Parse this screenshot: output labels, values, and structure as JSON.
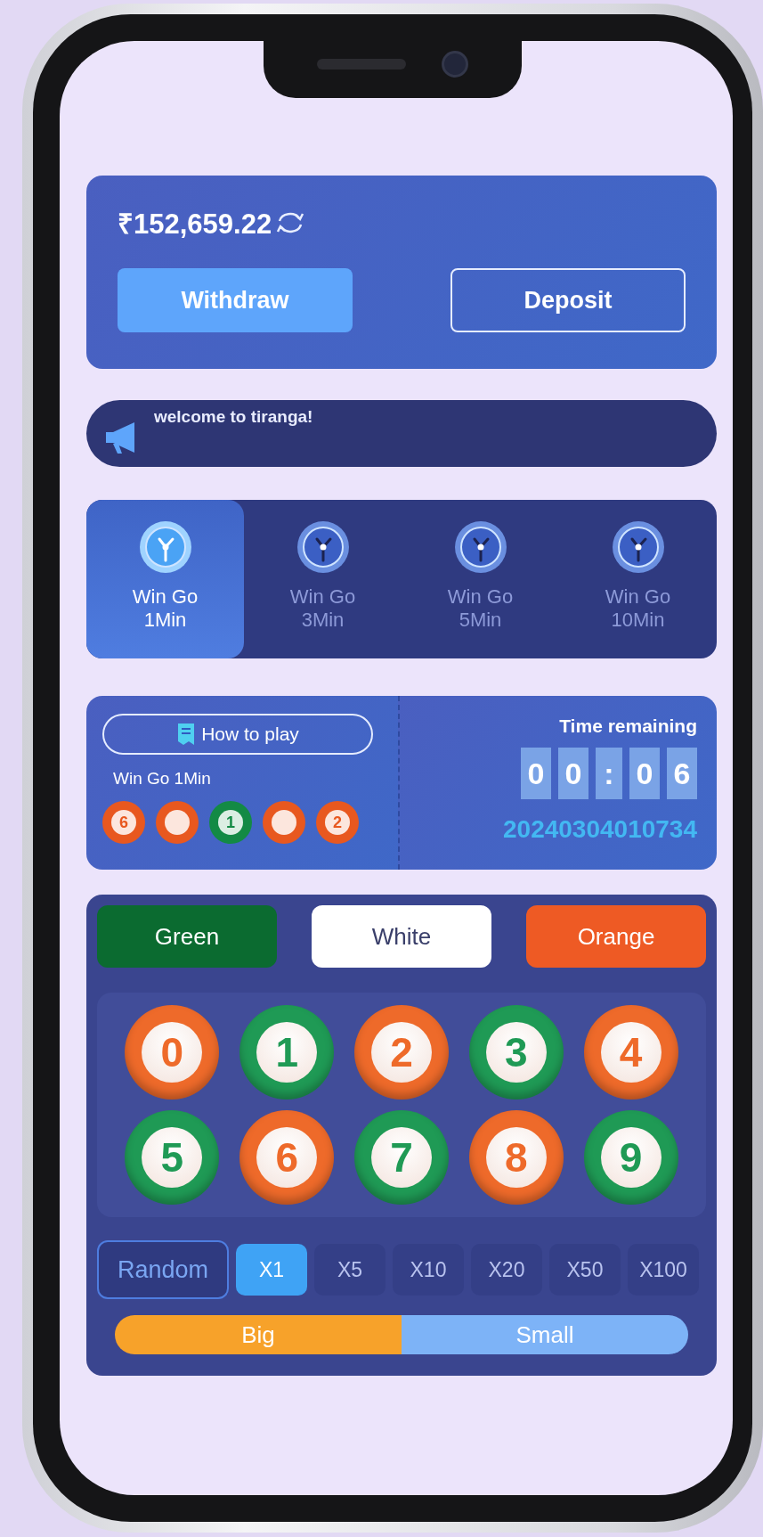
{
  "balance": {
    "amount": "₹152,659.22"
  },
  "actions": [
    {
      "label": "Withdraw",
      "kind": "primary"
    },
    {
      "label": "Deposit",
      "kind": "outline"
    }
  ],
  "notice": {
    "text": "welcome to tiranga!"
  },
  "games": [
    {
      "label": "Win Go",
      "duration": "1Min",
      "selected": true
    },
    {
      "label": "Win Go",
      "duration": "3Min",
      "selected": false
    },
    {
      "label": "Win Go",
      "duration": "5Min",
      "selected": false
    },
    {
      "label": "Win Go",
      "duration": "10Min",
      "selected": false
    }
  ],
  "round": {
    "how_to_play": "How to play",
    "game": "Win Go 1Min",
    "results": [
      {
        "number": "6",
        "color": "#e8581f"
      },
      {
        "color": "#e8581f"
      },
      {
        "number": "1",
        "color": "#138a45"
      },
      {
        "color": "#e8581f"
      },
      {
        "number": "2",
        "color": "#e8581f"
      }
    ],
    "time_label": "Time remaining",
    "timer": [
      "0",
      "0",
      ":",
      "0",
      "6"
    ],
    "period": "20240304010734"
  },
  "color_buttons": [
    {
      "label": "Green",
      "color": "#0b6b30"
    },
    {
      "label": "White",
      "color": "#ffffff"
    },
    {
      "label": "Orange",
      "color": "#ee5a24"
    }
  ],
  "numbers": [
    {
      "number": "0",
      "color": "#ee6a2a"
    },
    {
      "number": "1",
      "color": "#1f9a55"
    },
    {
      "number": "2",
      "color": "#ee6a2a"
    },
    {
      "number": "3",
      "color": "#1f9a55"
    },
    {
      "number": "4",
      "color": "#ee6a2a"
    },
    {
      "number": "5",
      "color": "#1f9a55"
    },
    {
      "number": "6",
      "color": "#ee6a2a"
    },
    {
      "number": "7",
      "color": "#1f9a55"
    },
    {
      "number": "8",
      "color": "#ee6a2a"
    },
    {
      "number": "9",
      "color": "#1f9a55"
    }
  ],
  "multipliers": {
    "random": "Random",
    "options": [
      {
        "label": "X1",
        "selected": true
      },
      {
        "label": "X5",
        "selected": false
      },
      {
        "label": "X10",
        "selected": false
      },
      {
        "label": "X20",
        "selected": false
      },
      {
        "label": "X50",
        "selected": false
      },
      {
        "label": "X100",
        "selected": false
      }
    ]
  },
  "bet": [
    {
      "label": "Big",
      "color": "#f7a22a"
    },
    {
      "label": "Small",
      "color": "#7db3f7"
    }
  ]
}
